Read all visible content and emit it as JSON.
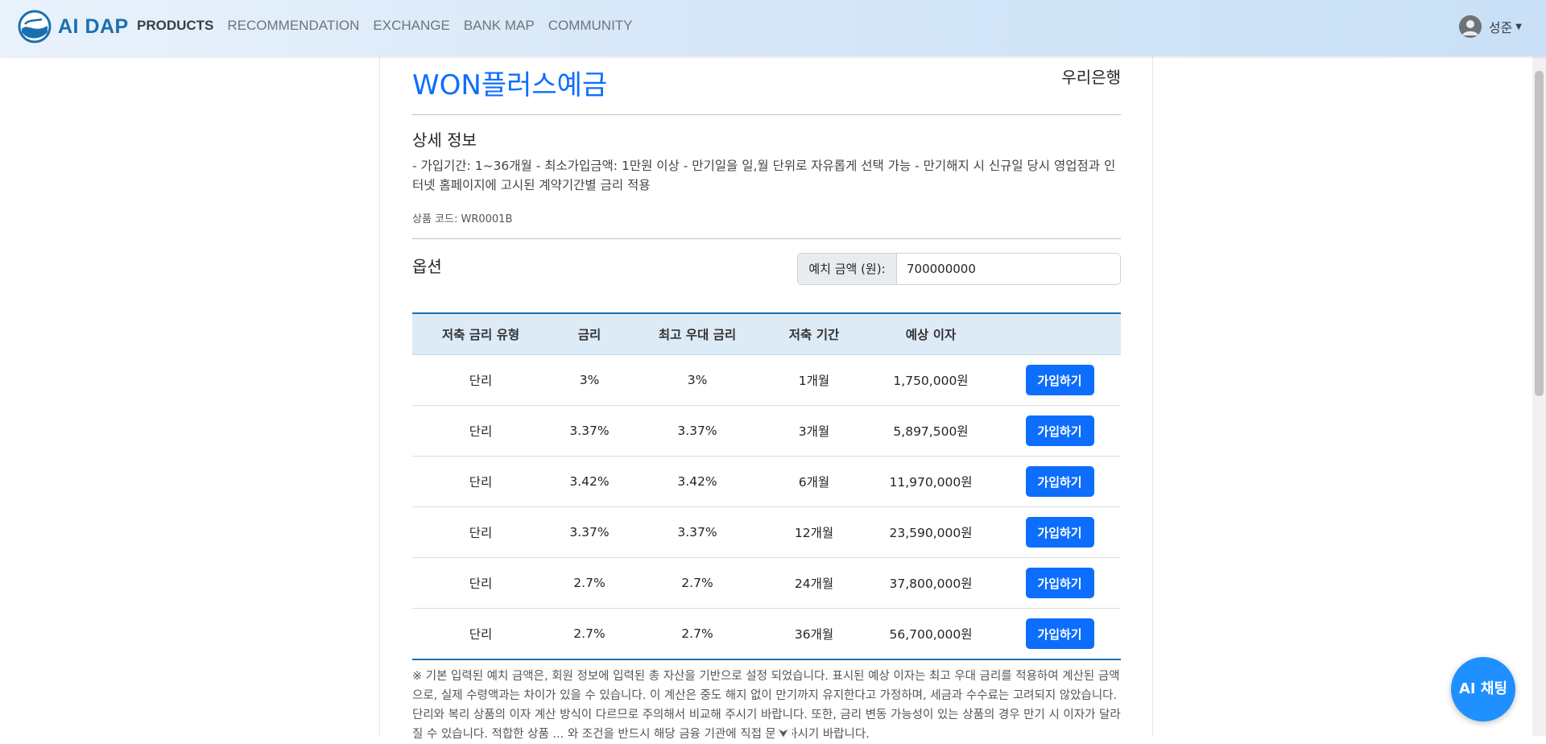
{
  "nav": {
    "brand": "AI DAP",
    "links": [
      "PRODUCTS",
      "RECOMMENDATION",
      "EXCHANGE",
      "BANK MAP",
      "COMMUNITY"
    ],
    "user_name": "성준"
  },
  "product": {
    "name": "WON플러스예금",
    "bank": "우리은행",
    "detail_title": "상세 정보",
    "description": "- 가입기간: 1~36개월 - 최소가입금액: 1만원 이상 - 만기일을 일,월 단위로 자유롭게 선택 가능 - 만기해지 시 신규일 당시 영업점과 인터넷 홈페이지에 고시된 계약기간별 금리 적용",
    "code": "상품 코드: WR0001B"
  },
  "options": {
    "title": "옵션",
    "deposit_label": "예치 금액 (원):",
    "deposit_value": "700000000"
  },
  "table": {
    "headers": [
      "저축 금리 유형",
      "금리",
      "최고 우대 금리",
      "저축 기간",
      "예상 이자",
      ""
    ],
    "button_label": "가입하기",
    "rows": [
      [
        "단리",
        "3%",
        "3%",
        "1개월",
        "1,750,000원"
      ],
      [
        "단리",
        "3.37%",
        "3.37%",
        "3개월",
        "5,897,500원"
      ],
      [
        "단리",
        "3.42%",
        "3.42%",
        "6개월",
        "11,970,000원"
      ],
      [
        "단리",
        "3.37%",
        "3.37%",
        "12개월",
        "23,590,000원"
      ],
      [
        "단리",
        "2.7%",
        "2.7%",
        "24개월",
        "37,800,000원"
      ],
      [
        "단리",
        "2.7%",
        "2.7%",
        "36개월",
        "56,700,000원"
      ]
    ]
  },
  "notice": "※ 기본 입력된 예치 금액은, 회원 정보에 입력된 총 자산을 기반으로 설정 되었습니다. 표시된 예상 이자는 최고 우대 금리를 적용하여 계산된 금액으로, 실제 수령액과는 차이가 있을 수 있습니다. 이 계산은 중도 해지 없이 만기까지 유지한다고 가정하며, 세금과 수수료는 고려되지 않았습니다. 단리와 복리 상품의 이자 계산 방식이 다르므로 주의해서 비교해 주시기 바랍니다. 또한, 금리 변동 가능성이 있는 상품의 경우 만기 시 이자가 달라질 수 있습니다. 적합한 상품 ... 와 조건을 반드시 해당 금융 기관에 직접 문의하시기 바랍니다.",
  "chat_button": "AI 채팅",
  "colors": {
    "accent": "#0d6efd",
    "brand": "#1a6fb0",
    "table_header": "#ddebf7"
  }
}
